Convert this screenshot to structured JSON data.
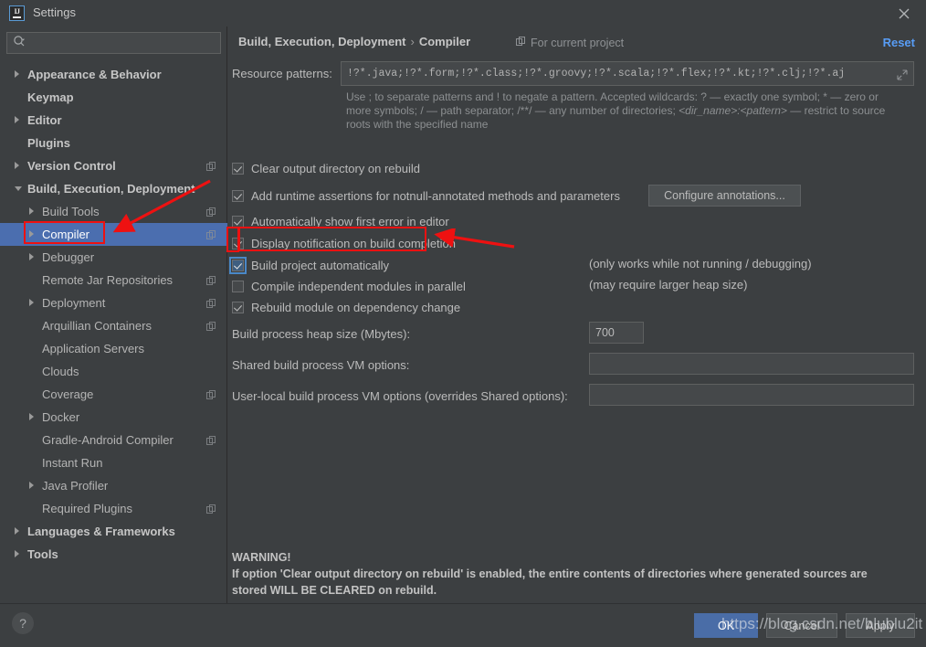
{
  "window": {
    "title": "Settings",
    "logo_text": "IJ",
    "close_icon": "close-icon"
  },
  "sidebar": {
    "search": {
      "placeholder": "",
      "value": "",
      "icon": "search-icon"
    },
    "items": [
      {
        "label": "Appearance & Behavior",
        "indent": 0,
        "arrow": "collapsed",
        "bold": true,
        "project_icon": false,
        "selected": false
      },
      {
        "label": "Keymap",
        "indent": 0,
        "arrow": "none",
        "bold": true,
        "project_icon": false,
        "selected": false
      },
      {
        "label": "Editor",
        "indent": 0,
        "arrow": "collapsed",
        "bold": true,
        "project_icon": false,
        "selected": false
      },
      {
        "label": "Plugins",
        "indent": 0,
        "arrow": "none",
        "bold": true,
        "project_icon": false,
        "selected": false
      },
      {
        "label": "Version Control",
        "indent": 0,
        "arrow": "collapsed",
        "bold": true,
        "project_icon": true,
        "selected": false
      },
      {
        "label": "Build, Execution, Deployment",
        "indent": 0,
        "arrow": "expanded",
        "bold": true,
        "project_icon": false,
        "selected": false
      },
      {
        "label": "Build Tools",
        "indent": 1,
        "arrow": "collapsed",
        "bold": false,
        "project_icon": true,
        "selected": false
      },
      {
        "label": "Compiler",
        "indent": 1,
        "arrow": "collapsed",
        "bold": false,
        "project_icon": true,
        "selected": true
      },
      {
        "label": "Debugger",
        "indent": 1,
        "arrow": "collapsed",
        "bold": false,
        "project_icon": false,
        "selected": false
      },
      {
        "label": "Remote Jar Repositories",
        "indent": 1,
        "arrow": "none",
        "bold": false,
        "project_icon": true,
        "selected": false
      },
      {
        "label": "Deployment",
        "indent": 1,
        "arrow": "collapsed",
        "bold": false,
        "project_icon": true,
        "selected": false
      },
      {
        "label": "Arquillian Containers",
        "indent": 1,
        "arrow": "none",
        "bold": false,
        "project_icon": true,
        "selected": false
      },
      {
        "label": "Application Servers",
        "indent": 1,
        "arrow": "none",
        "bold": false,
        "project_icon": false,
        "selected": false
      },
      {
        "label": "Clouds",
        "indent": 1,
        "arrow": "none",
        "bold": false,
        "project_icon": false,
        "selected": false
      },
      {
        "label": "Coverage",
        "indent": 1,
        "arrow": "none",
        "bold": false,
        "project_icon": true,
        "selected": false
      },
      {
        "label": "Docker",
        "indent": 1,
        "arrow": "collapsed",
        "bold": false,
        "project_icon": false,
        "selected": false
      },
      {
        "label": "Gradle-Android Compiler",
        "indent": 1,
        "arrow": "none",
        "bold": false,
        "project_icon": true,
        "selected": false
      },
      {
        "label": "Instant Run",
        "indent": 1,
        "arrow": "none",
        "bold": false,
        "project_icon": false,
        "selected": false
      },
      {
        "label": "Java Profiler",
        "indent": 1,
        "arrow": "collapsed",
        "bold": false,
        "project_icon": false,
        "selected": false
      },
      {
        "label": "Required Plugins",
        "indent": 1,
        "arrow": "none",
        "bold": false,
        "project_icon": true,
        "selected": false
      },
      {
        "label": "Languages & Frameworks",
        "indent": 0,
        "arrow": "collapsed",
        "bold": true,
        "project_icon": false,
        "selected": false
      },
      {
        "label": "Tools",
        "indent": 0,
        "arrow": "collapsed",
        "bold": true,
        "project_icon": false,
        "selected": false
      }
    ]
  },
  "main": {
    "breadcrumb": {
      "parent": "Build, Execution, Deployment",
      "separator": "›",
      "current": "Compiler"
    },
    "scope_note": "For current project",
    "reset_label": "Reset",
    "resource_patterns": {
      "label": "Resource patterns:",
      "value": "!?*.java;!?*.form;!?*.class;!?*.groovy;!?*.scala;!?*.flex;!?*.kt;!?*.clj;!?*.aj",
      "hint_part1": "Use ; to separate patterns and ! to negate a pattern. Accepted wildcards: ? — exactly one symbol; * — zero or more symbols; / — path separator; /**/ — any number of directories; ",
      "hint_italic": "<dir_name>:<pattern>",
      "hint_part2": " — restrict to source roots with the specified name"
    },
    "checkboxes": [
      {
        "label": "Clear output directory on rebuild",
        "checked": true,
        "focused": false
      },
      {
        "label": "Add runtime assertions for notnull-annotated methods and parameters",
        "checked": true,
        "focused": false
      },
      {
        "label": "Automatically show first error in editor",
        "checked": true,
        "focused": false
      },
      {
        "label": "Display notification on build completion",
        "checked": true,
        "focused": false
      },
      {
        "label": "Build project automatically",
        "checked": true,
        "focused": true
      },
      {
        "label": "Compile independent modules in parallel",
        "checked": false,
        "focused": false
      },
      {
        "label": "Rebuild module on dependency change",
        "checked": true,
        "focused": false
      }
    ],
    "configure_annotations_label": "Configure annotations...",
    "notes": [
      "(only works while not running / debugging)",
      "(may require larger heap size)"
    ],
    "fields": [
      {
        "label": "Build process heap size (Mbytes):",
        "value": "700"
      },
      {
        "label": "Shared build process VM options:",
        "value": ""
      },
      {
        "label": "User-local build process VM options (overrides Shared options):",
        "value": ""
      }
    ],
    "warning": {
      "heading": "WARNING!",
      "line1": "If option 'Clear output directory on rebuild' is enabled, the entire contents of directories where generated sources are",
      "line2": "stored WILL BE CLEARED on rebuild."
    }
  },
  "footer": {
    "help_label": "?",
    "buttons": [
      {
        "label": "OK",
        "primary": true
      },
      {
        "label": "Cancel",
        "primary": false
      },
      {
        "label": "Apply",
        "primary": false
      }
    ]
  },
  "overlay": {
    "watermark": "https://blog.csdn.net/blublu2it"
  },
  "colors": {
    "background": "#3c3f41",
    "selection": "#4b6eaf",
    "accent_link": "#589df6",
    "annotation_red": "#ee1111",
    "primary_button": "#4a6da7"
  }
}
